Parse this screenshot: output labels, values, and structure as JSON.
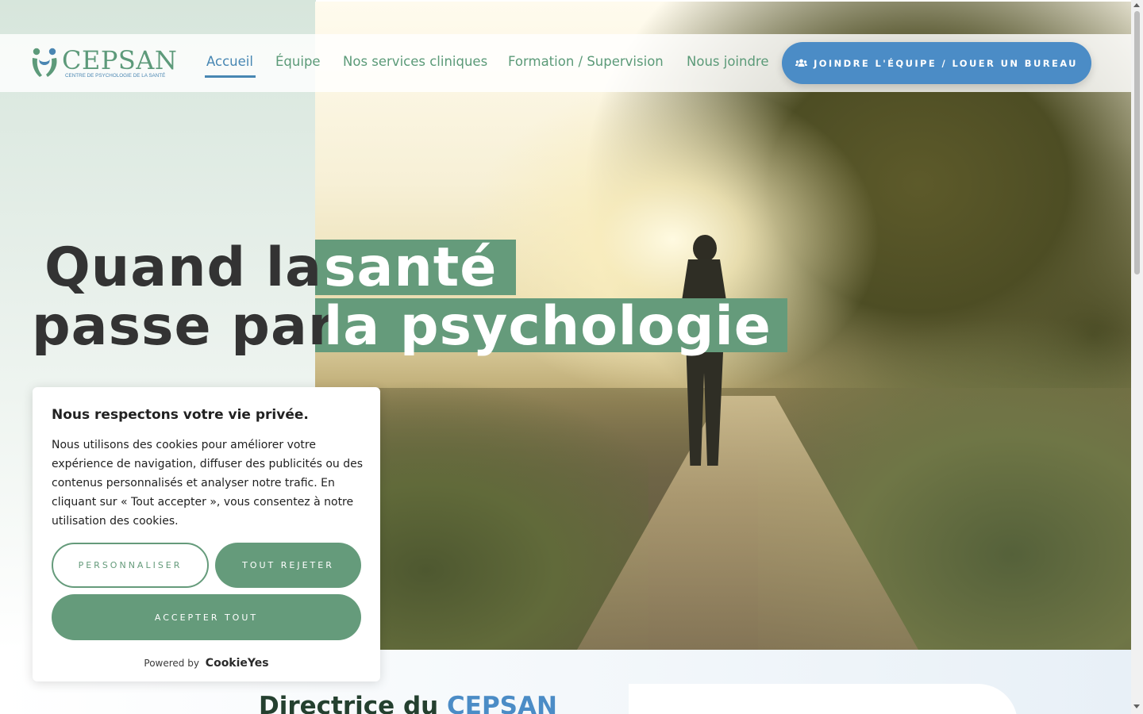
{
  "brand": {
    "name": "CEPSAN",
    "subtitle": "CENTRE DE PSYCHOLOGIE DE LA SANTÉ",
    "logo_icon": "two-people-icon"
  },
  "nav": {
    "items": [
      {
        "label": "Accueil",
        "active": true
      },
      {
        "label": "Équipe",
        "active": false
      },
      {
        "label": "Nos services cliniques",
        "active": false
      },
      {
        "label": "Formation / Supervision",
        "active": false
      },
      {
        "label": "Nous joindre",
        "active": false
      }
    ],
    "cta": {
      "label": "JOINDRE L'ÉQUIPE / LOUER UN BUREAU",
      "icon": "users-icon"
    }
  },
  "hero": {
    "line1_plain": "Quand la",
    "line1_highlight": "santé",
    "line2_plain": "passe par",
    "line2_highlight": "la psychologie",
    "image": "person-walking-on-path-at-sunrise"
  },
  "section": {
    "title_prefix": "Directrice du",
    "title_accent": "CEPSAN"
  },
  "cookie_banner": {
    "title": "Nous respectons votre vie privée.",
    "text": "Nous utilisons des cookies pour améliorer votre expérience de navigation, diffuser des publicités ou des contenus personnalisés et analyser notre trafic. En cliquant sur « Tout accepter », vous consentez à notre utilisation des cookies.",
    "customize_label": "PERSONNALISER",
    "reject_label": "TOUT REJETER",
    "accept_label": "ACCEPTER TOUT",
    "powered_by": "Powered by",
    "powered_brand": "CookieYes"
  },
  "colors": {
    "green": "#659b7b",
    "blue": "#4b8cc6",
    "nav_green": "#5b9a78",
    "dark_text": "#333333"
  }
}
